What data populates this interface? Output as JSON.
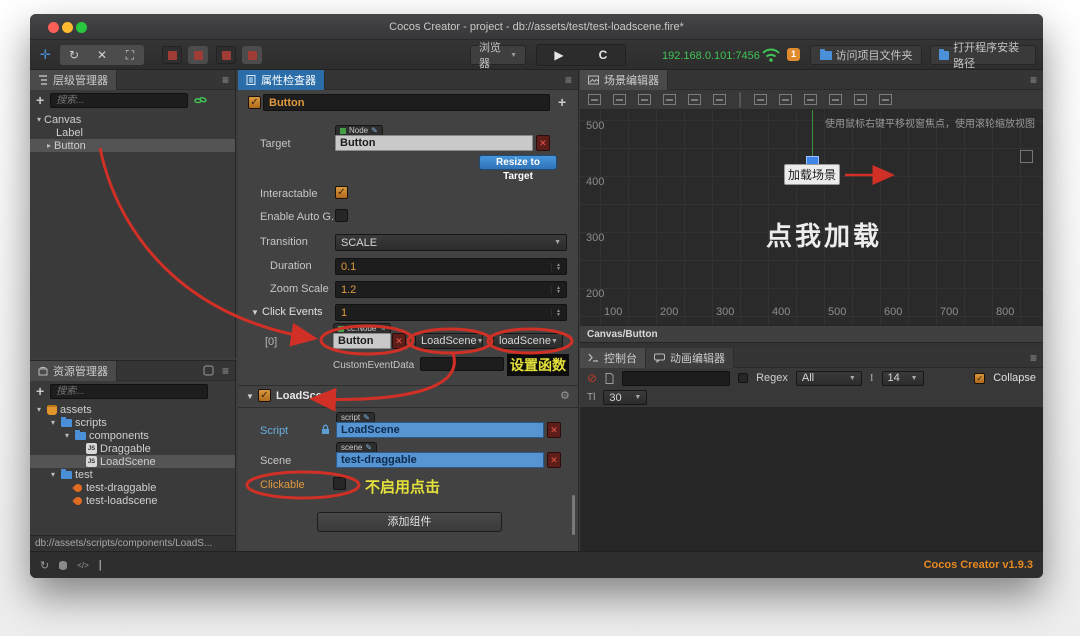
{
  "window": {
    "title": "Cocos Creator - project - db://assets/test/test-loadscene.fire*"
  },
  "toolbar": {
    "browser_label": "浏览器",
    "play_icon": "▶",
    "refresh_icon": "C",
    "ip": "192.168.0.101:7456",
    "badge": "1",
    "open_project_folder": "访问项目文件夹",
    "open_install_path": "打开程序安装路径"
  },
  "hierarchy": {
    "title": "层级管理器",
    "search_placeholder": "搜索...",
    "nodes": [
      {
        "label": "Canvas"
      },
      {
        "label": "Label"
      },
      {
        "label": "Button"
      }
    ]
  },
  "assets": {
    "title": "资源管理器",
    "search_placeholder": "搜索...",
    "items": [
      {
        "label": "assets"
      },
      {
        "label": "scripts"
      },
      {
        "label": "components"
      },
      {
        "label": "Draggable"
      },
      {
        "label": "LoadScene"
      },
      {
        "label": "test"
      },
      {
        "label": "test-draggable"
      },
      {
        "label": "test-loadscene"
      }
    ],
    "path": "db://assets/scripts/components/LoadS..."
  },
  "inspector": {
    "title": "属性检查器",
    "node_name": "Button",
    "target_label": "Target",
    "target_tag": "Node",
    "target_value": "Button",
    "resize_label": "Resize to Target",
    "interactable_label": "Interactable",
    "enable_auto_label": "Enable Auto G..",
    "transition_label": "Transition",
    "transition_value": "SCALE",
    "duration_label": "Duration",
    "duration_value": "0.1",
    "zoom_label": "Zoom Scale",
    "zoom_value": "1.2",
    "click_events_label": "Click Events",
    "click_events_value": "1",
    "event_index": "[0]",
    "event_tag": "cc.Node",
    "event_node": "Button",
    "event_component": "LoadScene",
    "event_handler": "loadScene",
    "custom_event_label": "CustomEventData",
    "component_name": "LoadScene",
    "script_label": "Script",
    "script_tag": "script",
    "script_value": "LoadScene",
    "scene_label": "Scene",
    "scene_tag": "scene",
    "scene_value": "test-draggable",
    "clickable_label": "Clickable",
    "add_component_label": "添加组件"
  },
  "scene": {
    "title": "场景编辑器",
    "hint": "使用鼠标右键平移视窗焦点，使用滚轮缩放视图",
    "button_label": "加载场景",
    "big_text": "点我加载",
    "breadcrumb": "Canvas/Button",
    "y_ticks": [
      "500",
      "400",
      "300",
      "200"
    ],
    "x_ticks": [
      "100",
      "200",
      "300",
      "400",
      "500",
      "600",
      "700",
      "800"
    ]
  },
  "console": {
    "tab_console": "控制台",
    "tab_anim": "动画编辑器",
    "regex_label": "Regex",
    "filter_value": "All",
    "fontsize_value": "14",
    "collapse_label": "Collapse",
    "lines_value": "30"
  },
  "annotations": {
    "set_function": "设置函数",
    "no_click": "不启用点击"
  },
  "footer": {
    "version": "Cocos Creator v1.9.3"
  }
}
